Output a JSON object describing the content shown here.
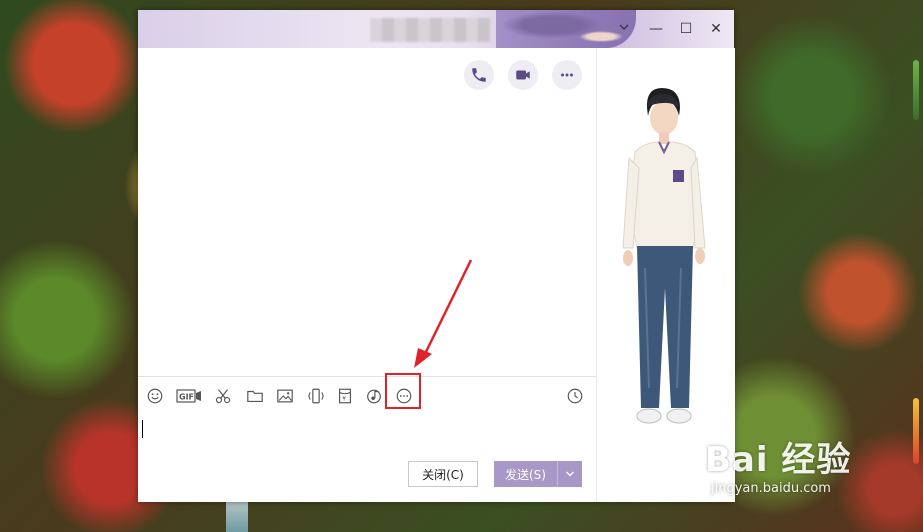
{
  "window": {
    "title_bar": {
      "minimize_label": "—",
      "maximize_label": "☐",
      "close_label": "✕",
      "collapse_label": "⌄"
    }
  },
  "chat_header": {
    "icons": [
      "phone-icon",
      "video-icon",
      "more-icon"
    ]
  },
  "toolbar": {
    "icons": [
      "emoji-icon",
      "gif-icon",
      "scissors-icon",
      "folder-icon",
      "image-icon",
      "shake-icon",
      "red-packet-icon",
      "music-icon",
      "more-options-icon",
      "history-clock-icon"
    ],
    "gif_label": "GIF"
  },
  "footer": {
    "close_button_label": "关闭(C)",
    "send_button_label": "发送(S)"
  },
  "watermark": {
    "logo": "Bai 经验",
    "url": "jingyan.baidu.com"
  },
  "colors": {
    "accent": "#a898c8",
    "highlight": "#e0232b",
    "icon": "#555555"
  }
}
